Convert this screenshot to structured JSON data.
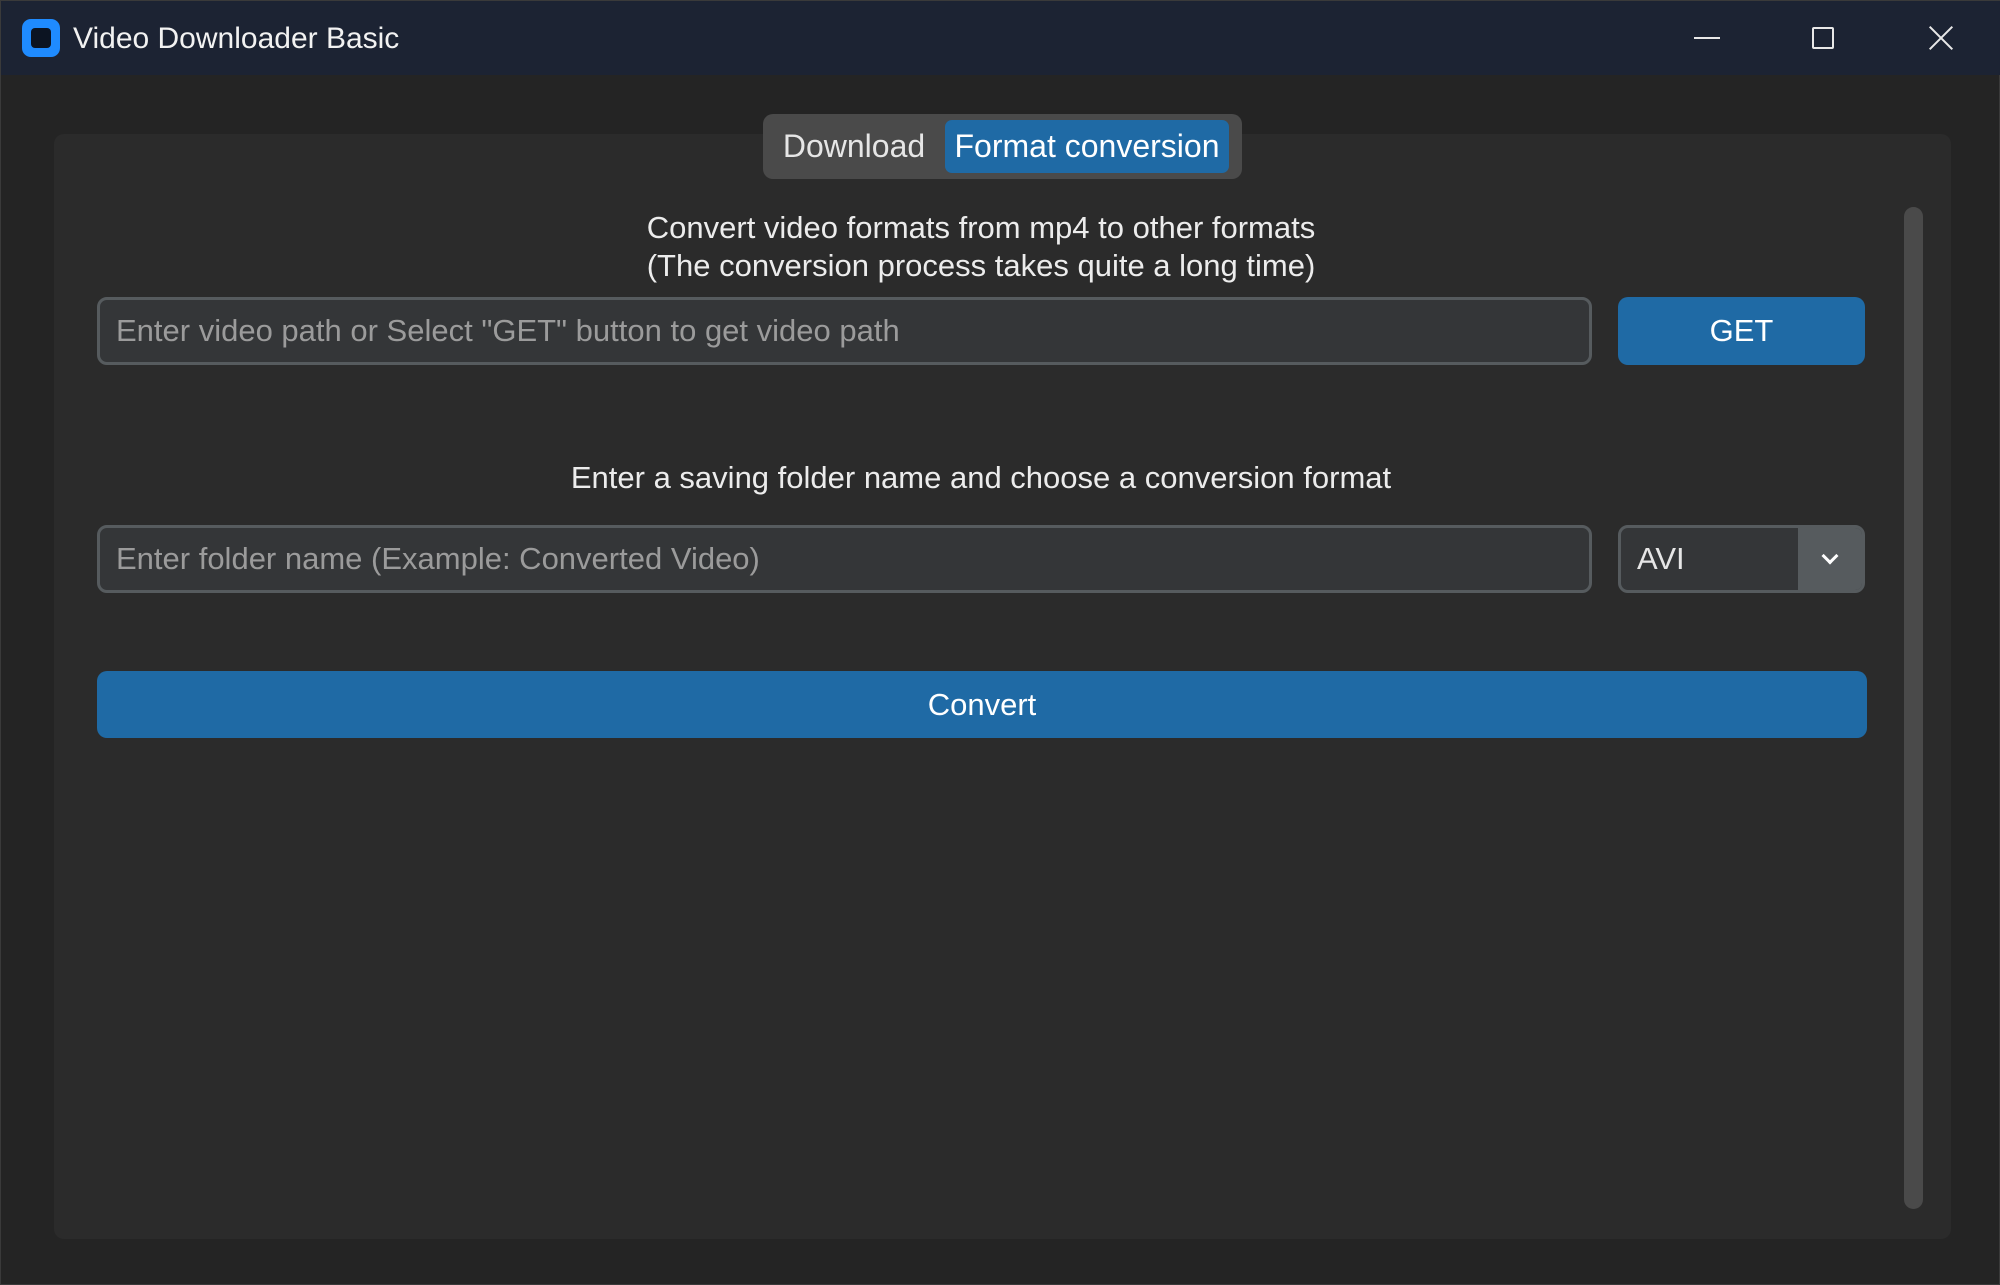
{
  "window": {
    "title": "Video Downloader Basic"
  },
  "tabs": [
    {
      "label": "Download",
      "selected": false
    },
    {
      "label": "Format conversion",
      "selected": true
    }
  ],
  "converter": {
    "description_line1": "Convert video formats from mp4 to other formats",
    "description_line2": "(The conversion process takes quite a long time)",
    "path_input": {
      "value": "",
      "placeholder": "Enter video path or Select \"GET\" button to get video path"
    },
    "get_button_label": "GET",
    "folder_prompt": "Enter a saving folder name and choose a conversion format",
    "folder_input": {
      "value": "",
      "placeholder": "Enter folder name (Example: Converted Video)"
    },
    "format_select": {
      "selected": "AVI"
    },
    "convert_button_label": "Convert"
  },
  "colors": {
    "accent": "#1f6aa5",
    "titlebar": "#1c2333",
    "panel": "#2b2b2b",
    "window_bg": "#242424",
    "input_bg": "#343638",
    "input_border": "#565b5e"
  },
  "icons": {
    "app": "app-logo-icon",
    "minimize": "minimize-icon",
    "maximize": "maximize-icon",
    "close": "close-icon",
    "dropdown": "chevron-down-icon"
  }
}
